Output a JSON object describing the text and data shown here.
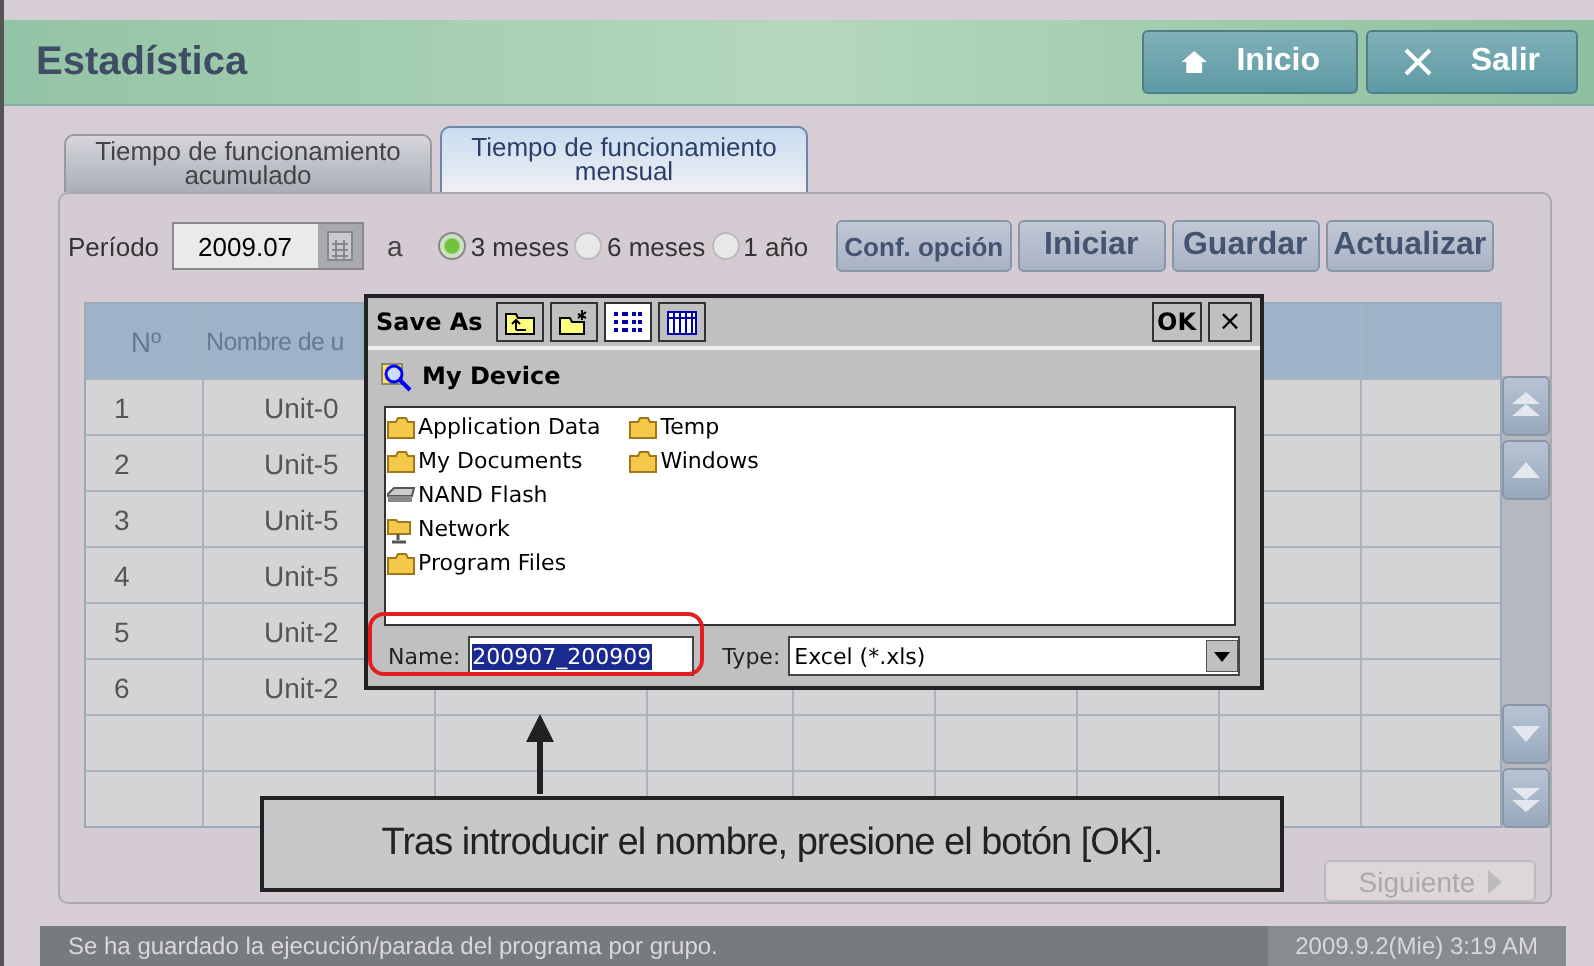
{
  "header": {
    "title": "Estadística",
    "buttons": [
      {
        "label": "Inicio",
        "kind": "home"
      },
      {
        "label": "Salir",
        "kind": "exit"
      }
    ]
  },
  "tabs": [
    {
      "label": "Tiempo de funcionamiento acumulado",
      "selected": false
    },
    {
      "label": "Tiempo de funcionamiento mensual",
      "selected": true
    }
  ],
  "period": {
    "label": "Período",
    "value": "2009.07",
    "separator": "a",
    "options": [
      {
        "label": "3 meses",
        "selected": true
      },
      {
        "label": "6 meses",
        "selected": false
      },
      {
        "label": "1 año",
        "selected": false
      }
    ]
  },
  "actions": [
    "Conf. opción",
    "Iniciar",
    "Guardar",
    "Actualizar"
  ],
  "table": {
    "columns": [
      "Nº",
      "Nombre de u"
    ],
    "rows": [
      [
        "1",
        "Unit-0"
      ],
      [
        "2",
        "Unit-5"
      ],
      [
        "3",
        "Unit-5"
      ],
      [
        "4",
        "Unit-5"
      ],
      [
        "5",
        "Unit-2"
      ],
      [
        "6",
        "Unit-2"
      ]
    ]
  },
  "pager": {
    "next": "Siguiente"
  },
  "dialog": {
    "title": "Save As",
    "ok": "OK",
    "close": "×",
    "location": "My Device",
    "items": [
      {
        "label": "Application Data",
        "kind": "folder"
      },
      {
        "label": "My Documents",
        "kind": "folder"
      },
      {
        "label": "NAND Flash",
        "kind": "drive"
      },
      {
        "label": "Network",
        "kind": "network"
      },
      {
        "label": "Program Files",
        "kind": "folder"
      },
      {
        "label": "Temp",
        "kind": "folder"
      },
      {
        "label": "Windows",
        "kind": "folder"
      }
    ],
    "name_label": "Name:",
    "name_value": "200907_200909",
    "type_label": "Type:",
    "type_value": "Excel (*.xls)"
  },
  "callout": "Tras introducir el nombre, presione el botón [OK].",
  "status_bar": {
    "message": "Se ha guardado la ejecución/parada del programa por grupo.",
    "datetime": "2009.9.2(Mie)  3:19 AM"
  }
}
